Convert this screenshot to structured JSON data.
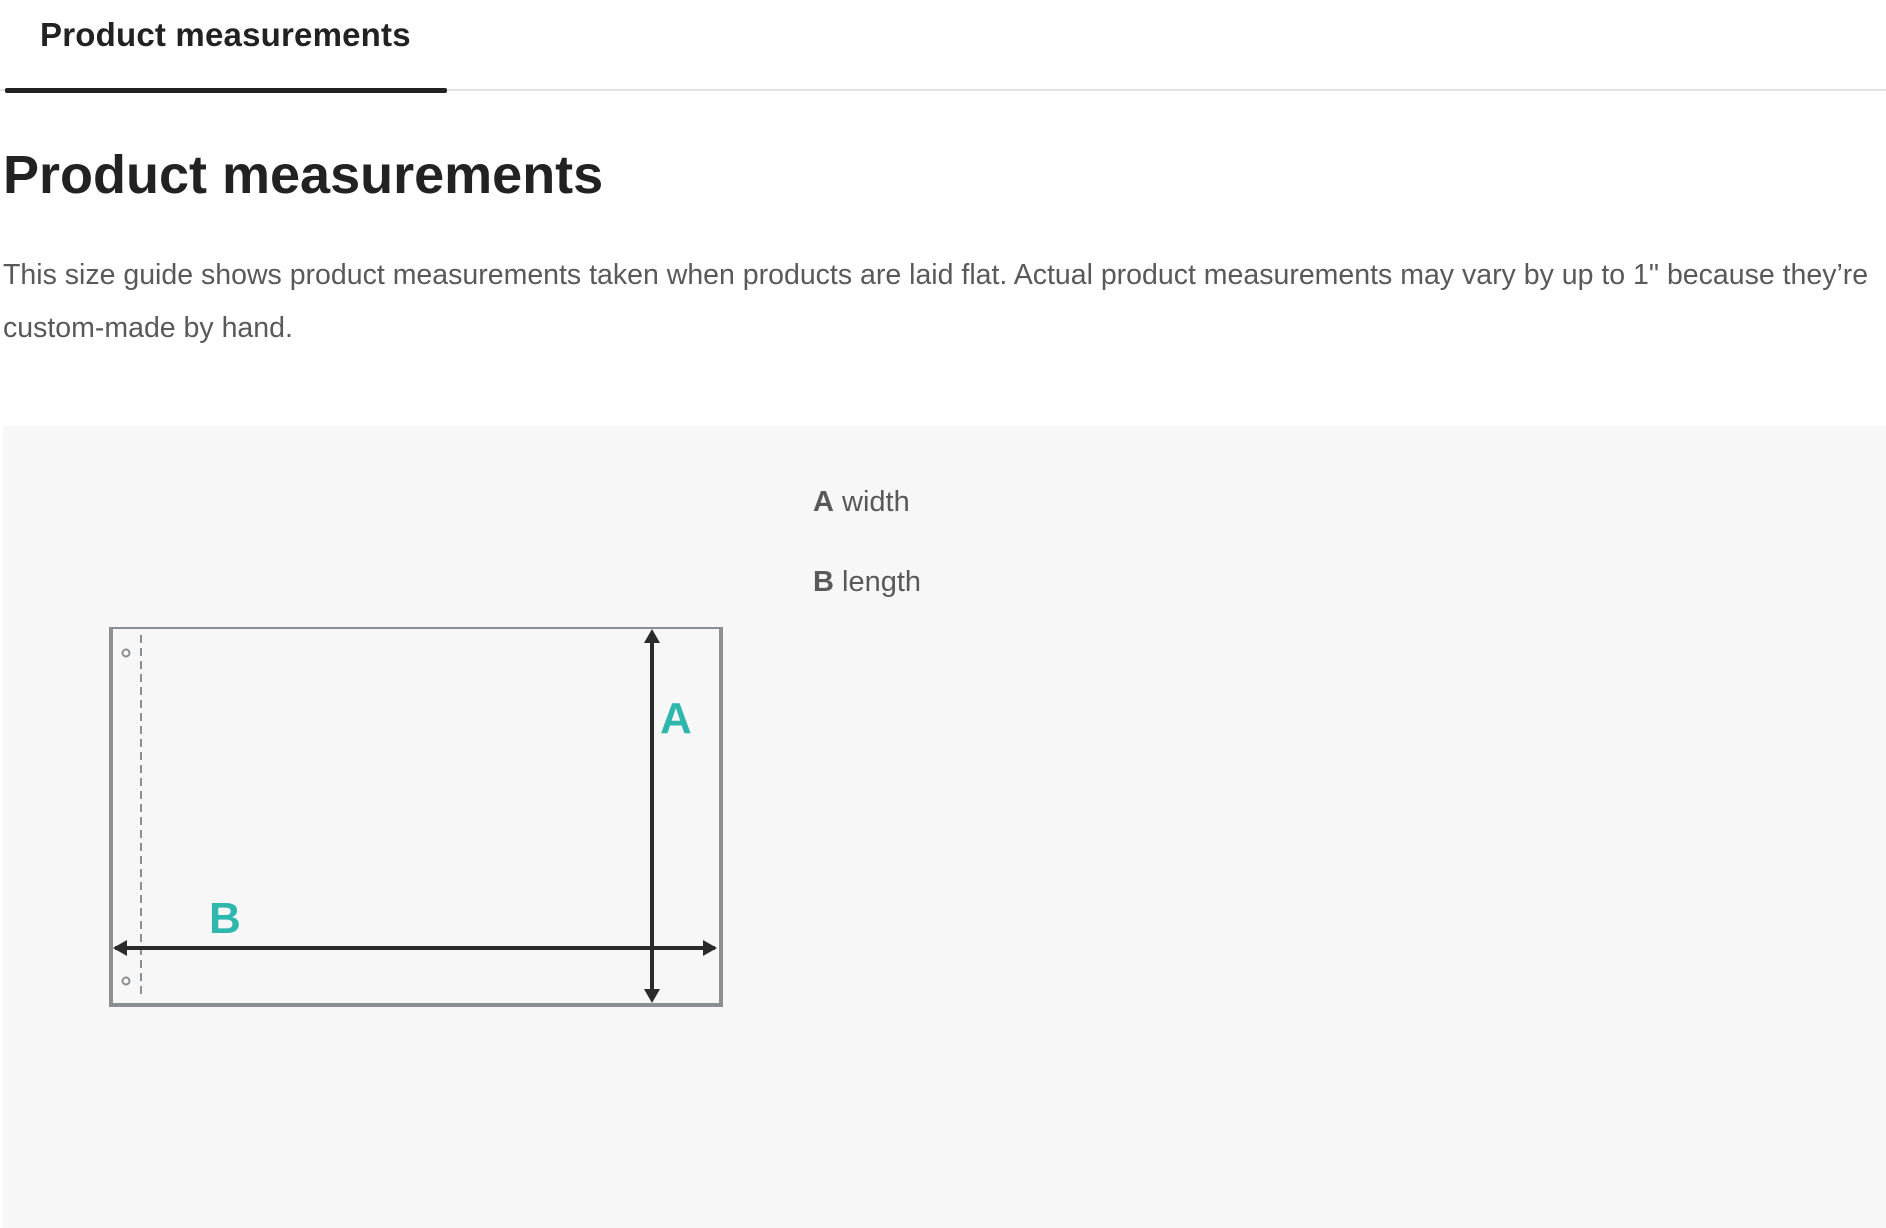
{
  "tabs": [
    {
      "label": "Product measurements",
      "active": true
    }
  ],
  "title": "Product measurements",
  "description": "This size guide shows product measurements taken when products are laid flat. Actual product measurements may vary by up to 1\" because they’re custom-made by hand.",
  "legend": [
    {
      "key": "A",
      "label": "width"
    },
    {
      "key": "B",
      "label": "length"
    }
  ],
  "diagram": {
    "labels": {
      "a": "A",
      "b": "B"
    },
    "accent_color": "#2fb7ae",
    "line_color": "#2b2b2b",
    "outline_color": "#8a8f94"
  }
}
